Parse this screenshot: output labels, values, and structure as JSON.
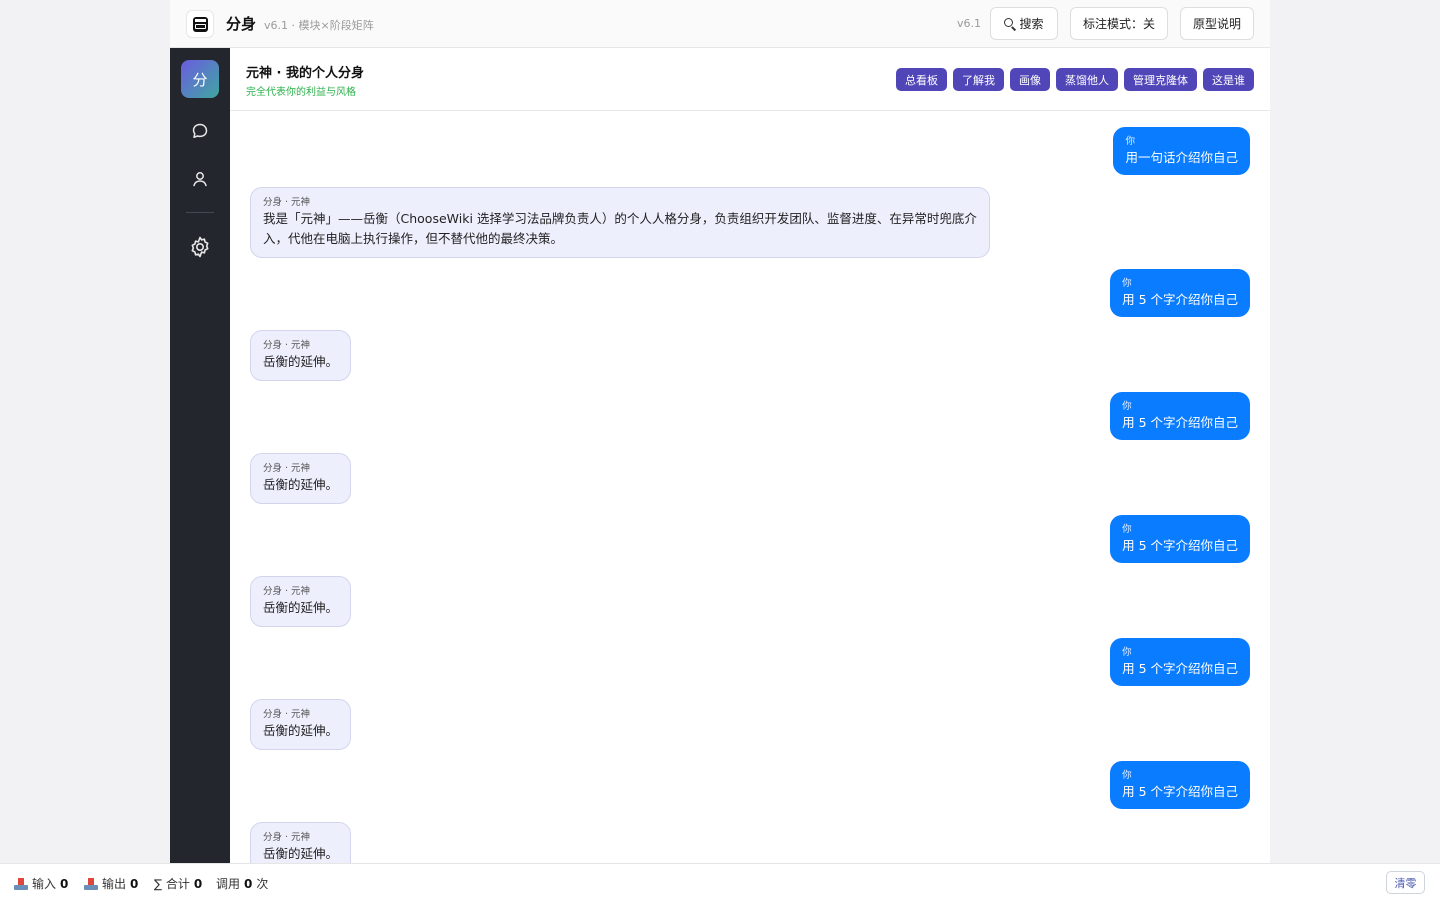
{
  "header": {
    "app_title": "分身",
    "app_subtitle": "v6.1 · 模块×阶段矩阵",
    "version": "v6.1",
    "search_label": "搜索",
    "mark_mode_label": "标注模式：关",
    "proto_label": "原型说明"
  },
  "sidebar": {
    "brand": "分",
    "items": [
      {
        "icon": "chat-icon"
      },
      {
        "icon": "user-icon"
      },
      {
        "icon": "gear-icon"
      }
    ]
  },
  "chat_header": {
    "title": "元神 · 我的个人分身",
    "subtitle": "完全代表你的利益与风格",
    "tags": [
      "总看板",
      "了解我",
      "画像",
      "蒸馏他人",
      "管理克隆体",
      "这是谁"
    ]
  },
  "messages": [
    {
      "role": "user",
      "who": "你",
      "text": "用一句话介绍你自己"
    },
    {
      "role": "bot",
      "who": "分身 · 元神",
      "text": "我是「元神」——岳衡（ChooseWiki 选择学习法品牌负责人）的个人人格分身，负责组织开发团队、监督进度、在异常时兜底介入，代他在电脑上执行操作，但不替代他的最终决策。"
    },
    {
      "role": "user",
      "who": "你",
      "text": "用 5 个字介绍你自己"
    },
    {
      "role": "bot",
      "who": "分身 · 元神",
      "text": "岳衡的延伸。"
    },
    {
      "role": "user",
      "who": "你",
      "text": "用 5 个字介绍你自己"
    },
    {
      "role": "bot",
      "who": "分身 · 元神",
      "text": "岳衡的延伸。"
    },
    {
      "role": "user",
      "who": "你",
      "text": "用 5 个字介绍你自己"
    },
    {
      "role": "bot",
      "who": "分身 · 元神",
      "text": "岳衡的延伸。"
    },
    {
      "role": "user",
      "who": "你",
      "text": "用 5 个字介绍你自己"
    },
    {
      "role": "bot",
      "who": "分身 · 元神",
      "text": "岳衡的延伸。"
    },
    {
      "role": "user",
      "who": "你",
      "text": "用 5 个字介绍你自己"
    },
    {
      "role": "bot",
      "who": "分身 · 元神",
      "text": "岳衡的延伸。"
    }
  ],
  "footer": {
    "input_label": "输入",
    "input_value": "0",
    "output_label": "输出",
    "output_value": "0",
    "total_label": "∑ 合计",
    "total_value": "0",
    "calls_label": "调用",
    "calls_value": "0",
    "calls_unit": "次",
    "clear_label": "清零"
  },
  "colors": {
    "user_bubble": "#0a7cff",
    "bot_bubble": "#eeeffd",
    "tag": "#5146b8",
    "sidebar": "#23262d",
    "subtitle_green": "#2bb04a"
  }
}
